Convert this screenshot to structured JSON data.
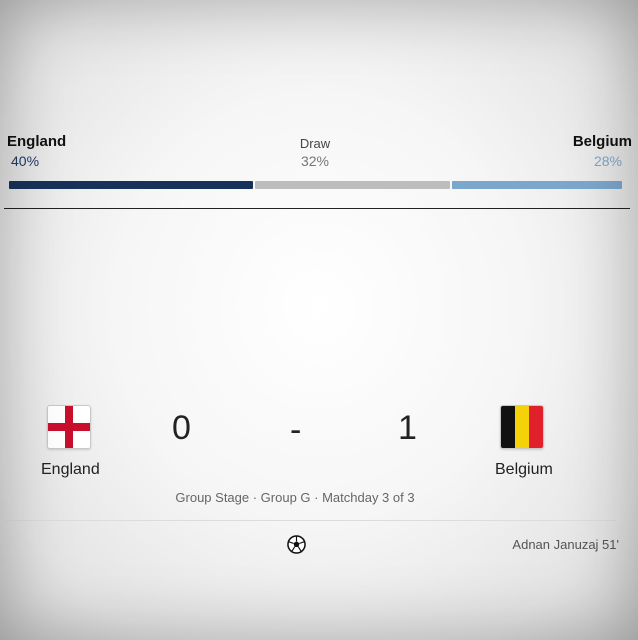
{
  "prediction": {
    "home": {
      "team": "England",
      "pct": "40%",
      "color": "#17325a",
      "value": 40
    },
    "draw": {
      "label": "Draw",
      "pct": "32%",
      "color": "#bdbdbd",
      "value": 32
    },
    "away": {
      "team": "Belgium",
      "pct": "28%",
      "color": "#7ca7cd",
      "value": 28
    }
  },
  "match": {
    "home": {
      "name": "England",
      "score": "0",
      "flag_icon": "england-flag-icon"
    },
    "separator": "-",
    "away": {
      "name": "Belgium",
      "score": "1",
      "flag_icon": "belgium-flag-icon"
    },
    "stage": "Group Stage · Group G · Matchday 3 of 3"
  },
  "events": [
    {
      "icon": "soccer-ball-icon",
      "player": "Adnan Januzaj 51'"
    }
  ]
}
